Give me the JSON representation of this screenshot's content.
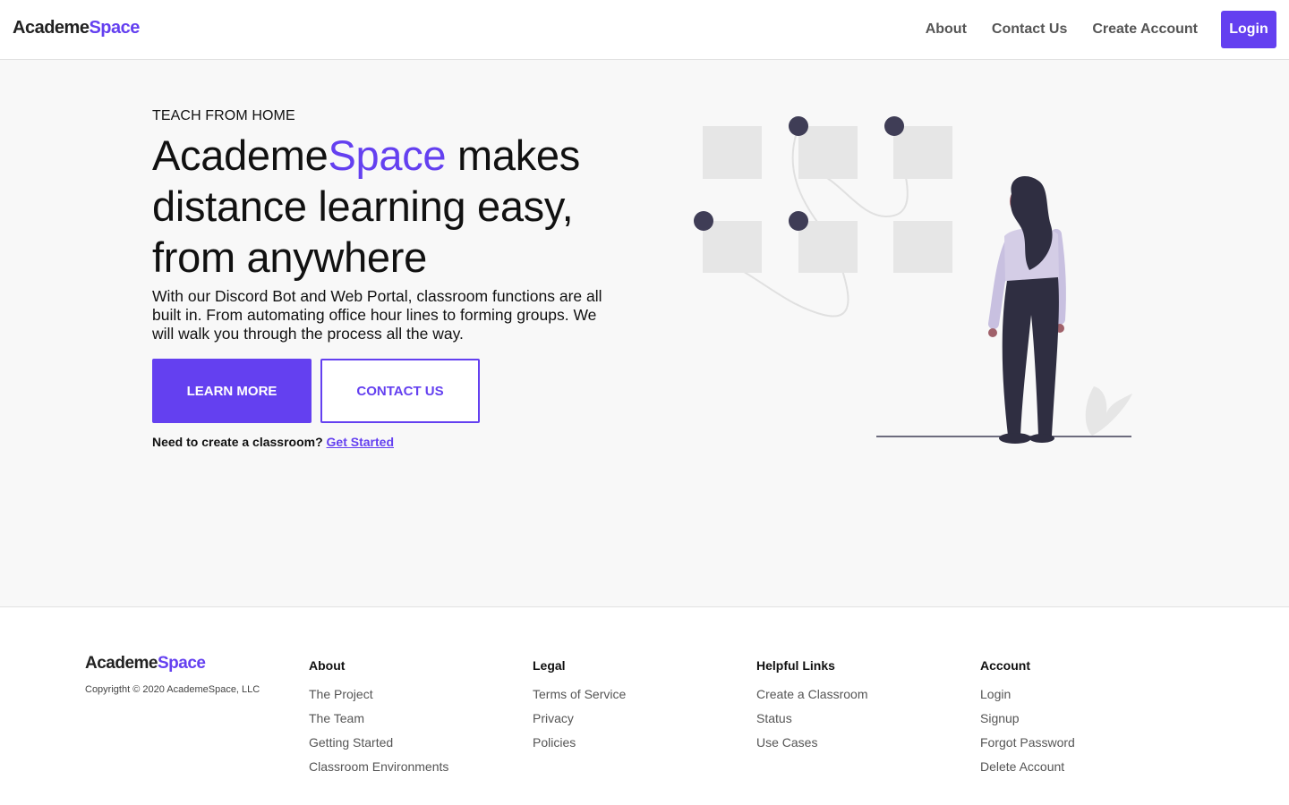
{
  "brand": {
    "name_part1": "Academe",
    "name_part2": "Space",
    "accent_color": "#6440f0"
  },
  "nav": {
    "links": [
      "About",
      "Contact Us",
      "Create Account"
    ],
    "login_label": "Login"
  },
  "hero": {
    "eyebrow": "TEACH FROM HOME",
    "headline_brand1": "Academe",
    "headline_brand2": "Space",
    "headline_rest": " makes distance learning easy, from anywhere",
    "description": "With our Discord Bot and Web Portal, classroom functions are all built in. From automating office hour lines to forming groups. We will walk you through the process all the way.",
    "learn_more_label": "LEARN MORE",
    "contact_label": "CONTACT US",
    "cta_text": "Need to create a classroom? ",
    "cta_link": "Get Started",
    "illustration_icon": "woman-viewing-board-illustration"
  },
  "footer": {
    "copyright": "Copyrigtht © 2020 AcademeSpace, LLC",
    "columns": [
      {
        "title": "About",
        "links": [
          "The Project",
          "The Team",
          "Getting Started",
          "Classroom Environments"
        ]
      },
      {
        "title": "Legal",
        "links": [
          "Terms of Service",
          "Privacy",
          "Policies"
        ]
      },
      {
        "title": "Helpful Links",
        "links": [
          "Create a Classroom",
          "Status",
          "Use Cases"
        ]
      },
      {
        "title": "Account",
        "links": [
          "Login",
          "Signup",
          "Forgot Password",
          "Delete Account"
        ]
      }
    ]
  }
}
